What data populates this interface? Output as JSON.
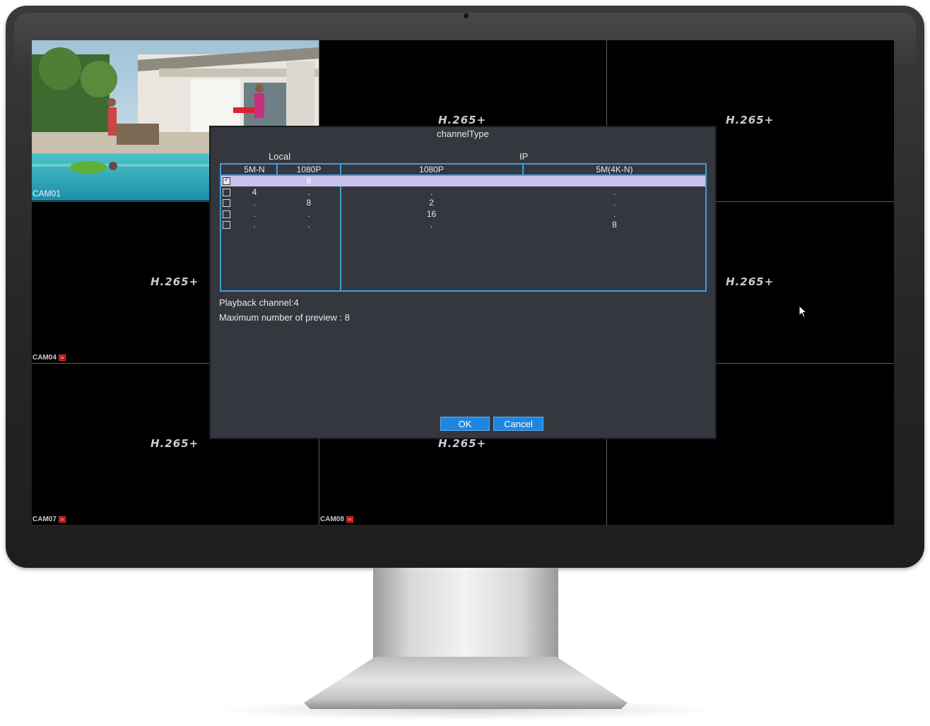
{
  "screen": {
    "codec_label": "H.265+",
    "cameras": {
      "cam01": "CAM01",
      "cam04": "CAM04",
      "cam07": "CAM07",
      "cam08": "CAM08"
    }
  },
  "dialog": {
    "title": "channelType",
    "groups": {
      "local": "Local",
      "ip": "IP"
    },
    "columns": [
      "5M-N",
      "1080P",
      "1080P",
      "5M(4K-N)"
    ],
    "rows": [
      {
        "selected": true,
        "checked": true,
        "values": [
          "",
          "8",
          "",
          ""
        ]
      },
      {
        "selected": false,
        "checked": false,
        "values": [
          "4",
          ".",
          ".",
          "."
        ]
      },
      {
        "selected": false,
        "checked": false,
        "values": [
          ".",
          "8",
          "2",
          "."
        ]
      },
      {
        "selected": false,
        "checked": false,
        "values": [
          ".",
          ".",
          "16",
          "."
        ]
      },
      {
        "selected": false,
        "checked": false,
        "values": [
          ".",
          ".",
          ".",
          "8"
        ]
      }
    ],
    "playback_channel": "Playback channel:4",
    "max_preview": "Maximum number of preview : 8",
    "ok_label": "OK",
    "cancel_label": "Cancel"
  },
  "colors": {
    "table_border": "#3e9ed6",
    "selected_row": "#c7c2ec",
    "button": "#1f86e0",
    "dialog_bg": "#35373f",
    "rec_badge": "#b01818"
  },
  "icons": [
    "record-icon",
    "checkbox-icon",
    "mouse-pointer-icon",
    "webcam-icon"
  ]
}
